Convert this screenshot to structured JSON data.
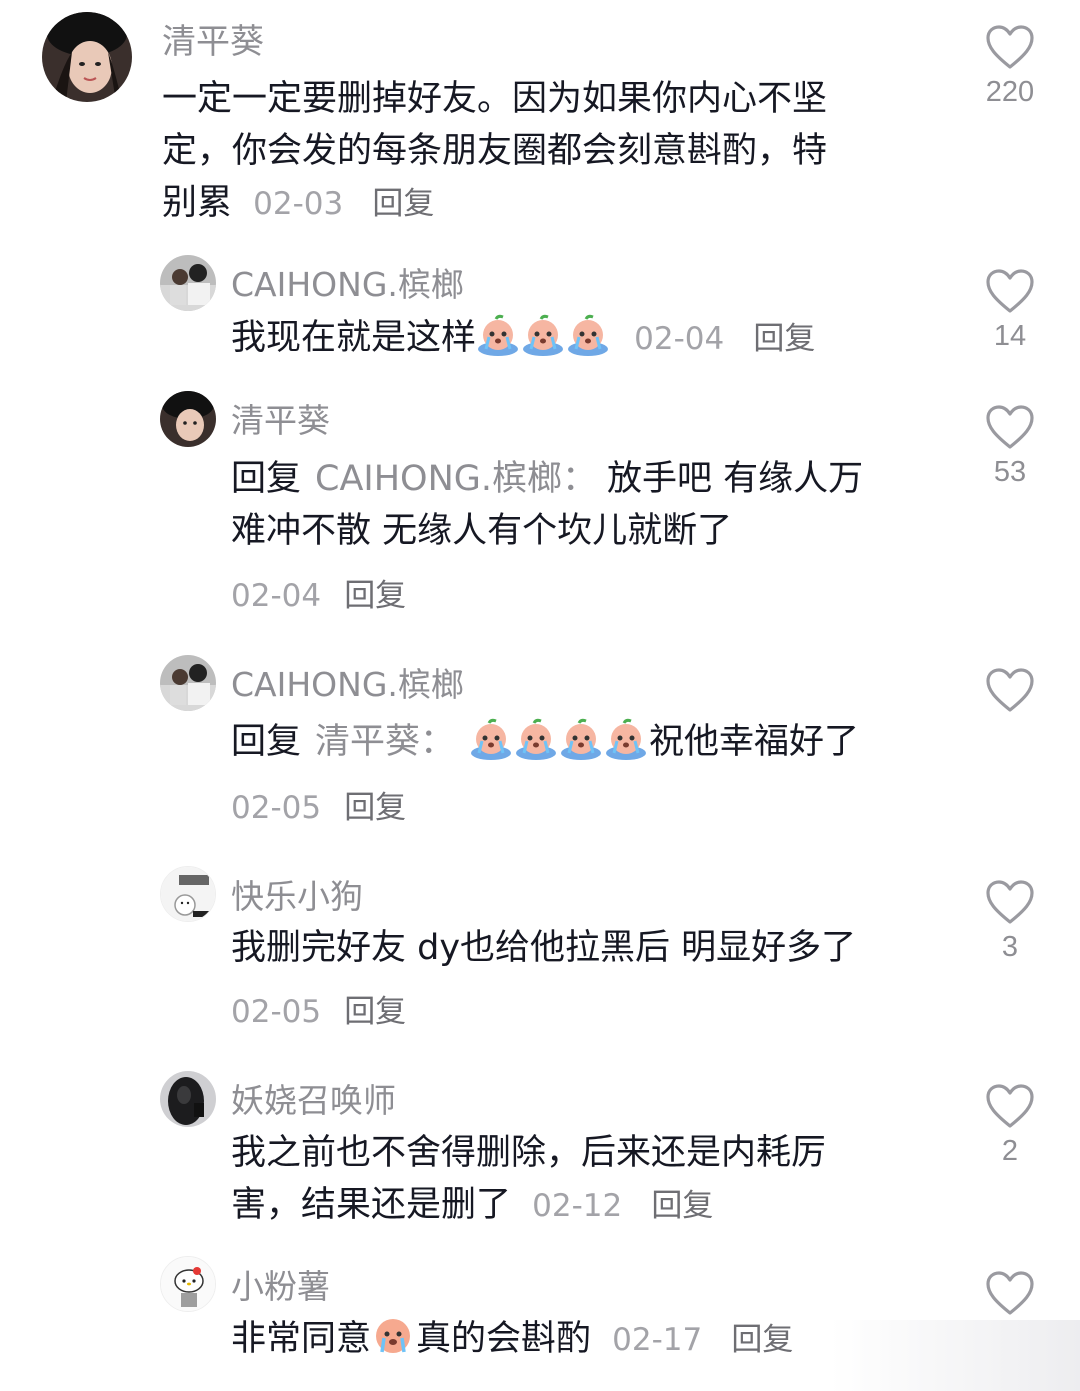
{
  "comments": [
    {
      "name": "清平葵",
      "avatar": "avatar-girl-hat",
      "text_lines": [
        "一定一定要删掉好友。因为如果你内心不坚",
        "定，你会发的每条朋友圈都会刻意斟酌，特",
        "别累"
      ],
      "date": "02-03",
      "reply": "回复",
      "likes": "220"
    },
    {
      "name": "CAIHONG.槟榔",
      "avatar": "avatar-photo-couple",
      "text": "我现在就是这样",
      "emoji_count": 3,
      "date": "02-04",
      "reply": "回复",
      "likes": "14"
    },
    {
      "name": "清平葵",
      "avatar": "avatar-girl-hat",
      "reply_prefix": "回复",
      "reply_target": "CAIHONG.槟榔：",
      "text_lines": [
        "放手吧 有缘人万",
        "难冲不散 无缘人有个坎儿就断了"
      ],
      "date": "02-04",
      "reply": "回复",
      "likes": "53"
    },
    {
      "name": "CAIHONG.槟榔",
      "avatar": "avatar-photo-couple",
      "reply_prefix": "回复",
      "reply_target": "清平葵：",
      "emoji_count": 4,
      "text": "祝他幸福好了",
      "date": "02-05",
      "reply": "回复",
      "likes": ""
    },
    {
      "name": "快乐小狗",
      "avatar": "avatar-cartoon-dog",
      "text": "我删完好友 dy也给他拉黑后 明显好多了",
      "date": "02-05",
      "reply": "回复",
      "likes": "3"
    },
    {
      "name": "妖娆召唤师",
      "avatar": "avatar-dark-selfie",
      "text_lines": [
        "我之前也不舍得删除，后来还是内耗厉",
        "害，结果还是删了"
      ],
      "date": "02-12",
      "reply": "回复",
      "likes": "2"
    },
    {
      "name": "小粉薯",
      "avatar": "avatar-hello-kitty",
      "text_a": "非常同意",
      "text_b": "真的会斟酌",
      "date": "02-17",
      "reply": "回复",
      "likes": ""
    }
  ],
  "colors": {
    "name": "#8e8e93",
    "text": "#161823",
    "meta": "#a3a3a8",
    "heart_outline": "#9a9aa0"
  },
  "icons": [
    "heart-outline-icon",
    "crying-emoji-icon"
  ]
}
